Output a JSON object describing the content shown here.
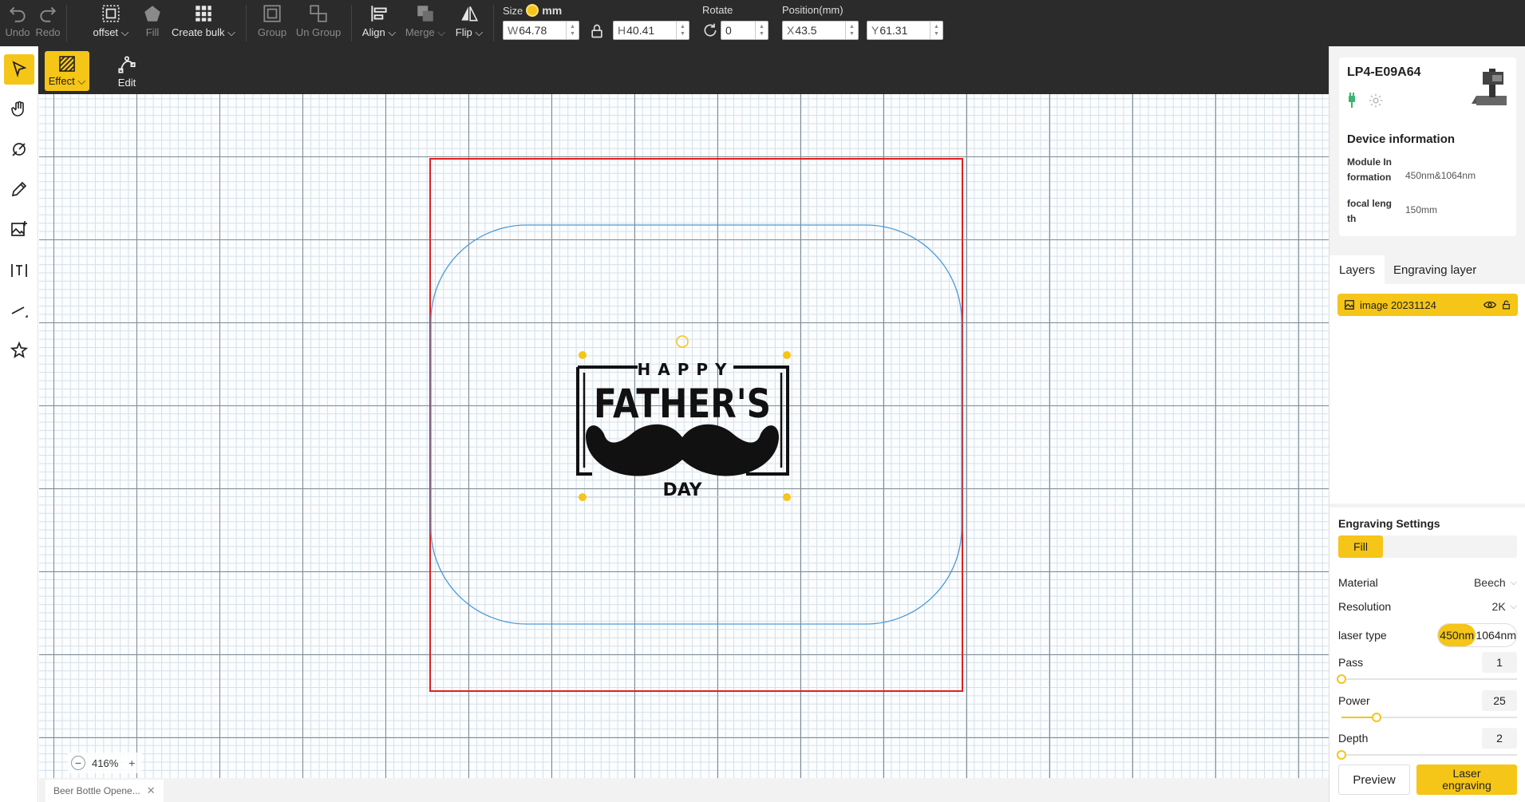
{
  "toolbar": {
    "undo": "Undo",
    "redo": "Redo",
    "offset": "offset",
    "fill": "Fill",
    "create_bulk": "Create bulk",
    "group": "Group",
    "ungroup": "Un Group",
    "align": "Align",
    "merge": "Merge",
    "flip": "Flip",
    "size_label": "Size",
    "unit": "mm",
    "width_prefix": "W",
    "width": "64.78",
    "height_prefix": "H",
    "height": "40.41",
    "rotate_label": "Rotate",
    "rotate": "0",
    "position_label": "Position(mm)",
    "x_prefix": "X",
    "x": "43.5",
    "y_prefix": "Y",
    "y": "61.31"
  },
  "subtoolbar": {
    "effect": "Effect",
    "edit": "Edit"
  },
  "canvas": {
    "zoom": "416%",
    "artwork": {
      "happy": "HAPPY",
      "fathers": "FATHER'S",
      "day": "DAY"
    }
  },
  "file_tab": {
    "name": "Beer Bottle Opene..."
  },
  "device": {
    "name": "LP4-E09A64",
    "info_title": "Device information",
    "module_key": "Module Information",
    "module_value": "450nm&1064nm",
    "focal_key": "focal length",
    "focal_value": "150mm"
  },
  "layers": {
    "tab_layers": "Layers",
    "tab_engraving": "Engraving layer",
    "items": [
      {
        "name": "image 20231124"
      }
    ]
  },
  "engraving": {
    "title": "Engraving Settings",
    "mode": "Fill",
    "material_label": "Material",
    "material": "Beech",
    "resolution_label": "Resolution",
    "resolution": "2K",
    "laser_type_label": "laser type",
    "laser_options": [
      "450nm",
      "1064nm"
    ],
    "pass_label": "Pass",
    "pass": "1",
    "pass_level": 0.0,
    "power_label": "Power",
    "power": "25",
    "power_level": 0.2,
    "depth_label": "Depth",
    "depth": "2",
    "depth_level": 0.0,
    "preview": "Preview",
    "laser_engraving": "Laser engraving"
  },
  "colors": {
    "accent": "#f5c518",
    "toolbar_bg": "#2b2b2b",
    "work_border": "#e02020",
    "shape_outline": "#4a9ad8"
  }
}
